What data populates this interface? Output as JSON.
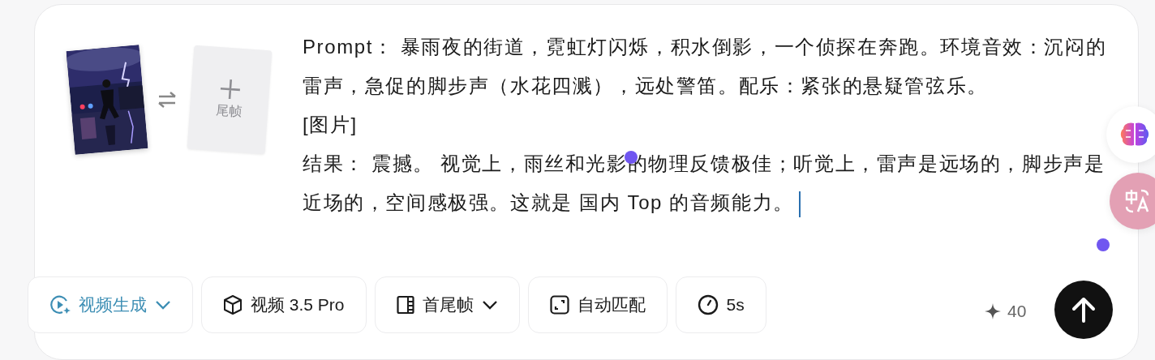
{
  "media": {
    "end_frame": {
      "label": "尾帧"
    }
  },
  "prompt": {
    "paragraphs": [
      "Prompt： 暴雨夜的街道，霓虹灯闪烁，积水倒影，一个侦探在奔跑。环境音效：沉闷的雷声，急促的脚步声（水花四溅），远处警笛。配乐：紧张的悬疑管弦乐。",
      "[图片]",
      "结果： 震撼。 视觉上，雨丝和光影的物理反馈极佳；听觉上，雷声是远场的，脚步声是近场的，空间感极强。这就是 国内 Top 的音频能力。"
    ]
  },
  "toolbar": [
    {
      "kind": "mode",
      "label": "视频生成",
      "active": true,
      "dropdown": true
    },
    {
      "kind": "model",
      "label": "视频 3.5 Pro",
      "active": false,
      "dropdown": false
    },
    {
      "kind": "frames",
      "label": "首尾帧",
      "active": false,
      "dropdown": true
    },
    {
      "kind": "ratio",
      "label": "自动匹配",
      "active": false,
      "dropdown": false
    },
    {
      "kind": "duration",
      "label": "5s",
      "active": false,
      "dropdown": false
    }
  ],
  "credits": "40"
}
